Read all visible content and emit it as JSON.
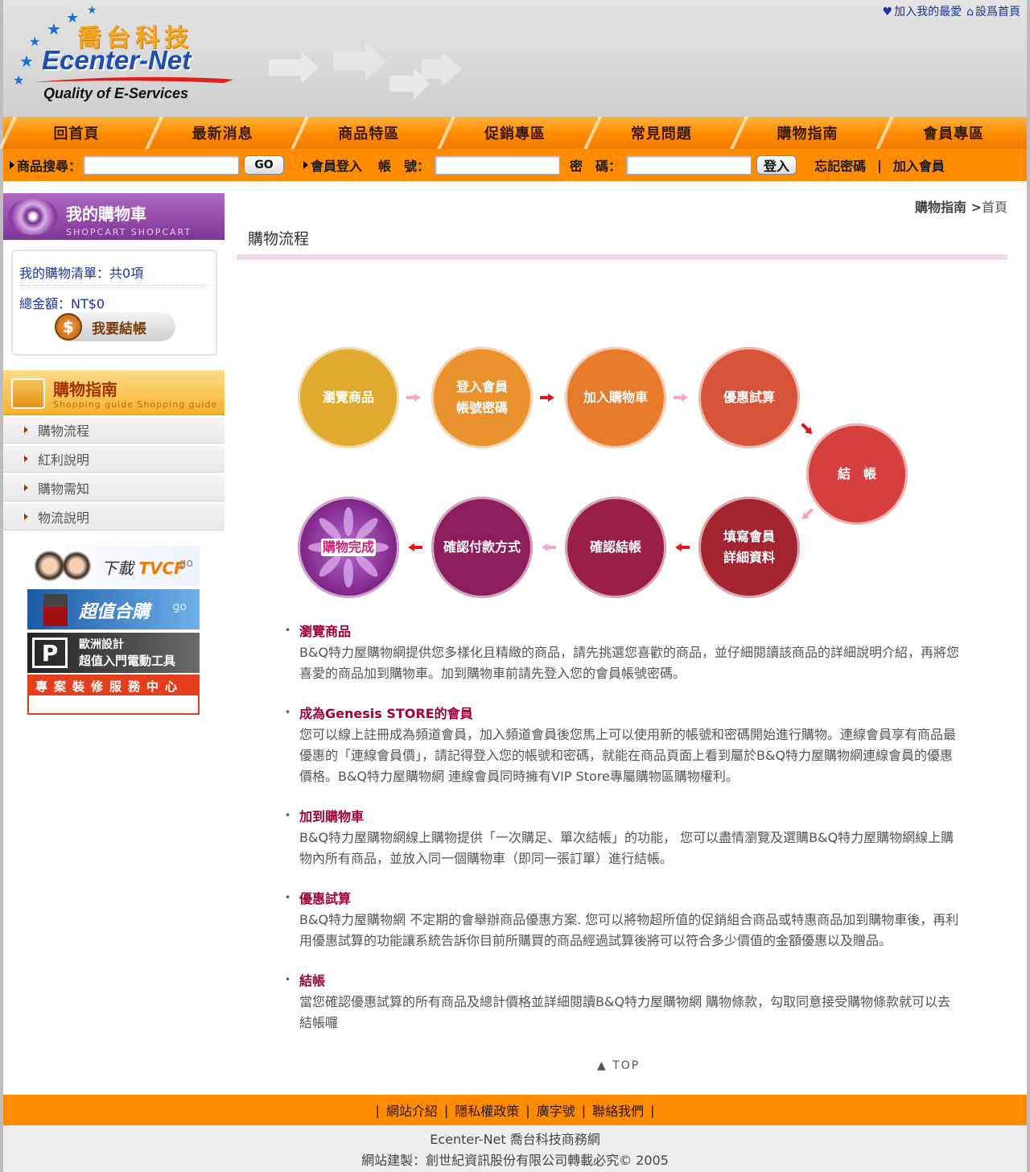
{
  "header": {
    "logo_cn": "喬台科技",
    "logo_en": "Ecenter-Net",
    "logo_tagline": "Quality of E-Services",
    "top_links": [
      {
        "label": "加入我的最愛",
        "icon": "heart-icon"
      },
      {
        "label": "設爲首頁",
        "icon": "home-icon"
      }
    ]
  },
  "nav": {
    "items": [
      "回首頁",
      "最新消息",
      "商品特區",
      "促銷專區",
      "常見問題",
      "購物指南",
      "會員專區"
    ]
  },
  "searchbar": {
    "search_label": "商品搜尋：",
    "search_value": "",
    "go_label": "GO",
    "login_label": "會員登入",
    "account_label": "帳　號：",
    "account_value": "",
    "password_label": "密　碼：",
    "password_value": "",
    "login_button": "登入",
    "forgot_label": "忘記密碼",
    "separator": "|",
    "join_label": "加入會員"
  },
  "cart": {
    "title": "我的購物車",
    "subtitle": "SHOPCART  SHOPCART",
    "list_label": "我的購物清單：共0項",
    "total_label": "總金額：NT$0",
    "checkout_label": "我要結帳",
    "dollar_symbol": "$"
  },
  "guide": {
    "title": "購物指南",
    "subtitle": "Shopping guide  Shopping guide",
    "items": [
      "購物流程",
      "紅利說明",
      "購物需知",
      "物流說明"
    ]
  },
  "banners": {
    "tvcf_text": "下載",
    "tvcf_brand": "TVCF",
    "tvcf_go": "go",
    "super_text": "超值合購",
    "super_go": "go",
    "euro_p": "P",
    "euro_line1": "歐洲設計",
    "euro_line2": "超值入門電動工具",
    "pro_text": "專案裝修服務中心"
  },
  "main": {
    "breadcrumb_section": "購物指南",
    "breadcrumb_sep": " >",
    "breadcrumb_page": "首頁",
    "title": "購物流程",
    "flow_steps": [
      {
        "line1": "瀏覽商品",
        "line2": "",
        "color": "#e0a92f"
      },
      {
        "line1": "登入會員",
        "line2": "帳號密碼",
        "color": "#ea922e"
      },
      {
        "line1": "加入購物車",
        "line2": "",
        "color": "#e87a2c"
      },
      {
        "line1": "優惠試算",
        "line2": "",
        "color": "#d6543a"
      },
      {
        "line1": "結　帳",
        "line2": "",
        "color": "#d6403e"
      },
      {
        "line1": "填寫會員",
        "line2": "詳細資料",
        "color": "#a52431"
      },
      {
        "line1": "確認結帳",
        "line2": "",
        "color": "#9a1f48"
      },
      {
        "line1": "確認付款方式",
        "line2": "",
        "color": "#8d1d5c"
      },
      {
        "line1": "購物完成",
        "line2": "",
        "color": "#7d2283"
      }
    ],
    "items": [
      {
        "title": "瀏覽商品",
        "text": "B&Q特力屋購物網提供您多樣化且精緻的商品，請先挑選您喜歡的商品，並仔細閱讀該商品的詳細說明介紹，再將您喜愛的商品加到購物車。加到購物車前請先登入您的會員帳號密碼。"
      },
      {
        "title": "成為Genesis STORE的會員",
        "text": "您可以線上註冊成為頻道會員，加入頻道會員後您馬上可以使用新的帳號和密碼開始進行購物。連線會員享有商品最優惠的「連線會員價」，請記得登入您的帳號和密碼，就能在商品頁面上看到屬於B&Q特力屋購物網連線會員的優惠價格。B&Q特力屋購物網 連線會員同時擁有VIP Store專屬購物區購物權利。"
      },
      {
        "title": "加到購物車",
        "text": "B&Q特力屋購物網線上購物提供「一次購足、單次結帳」的功能， 您可以盡情瀏覽及選購B&Q特力屋購物網線上購物內所有商品，並放入同一個購物車（即同一張訂單）進行結帳。"
      },
      {
        "title": "優惠試算",
        "text": "B&Q特力屋購物網 不定期的會舉辦商品優惠方案. 您可以將物超所值的促銷組合商品或特惠商品加到購物車後，再利用優惠試算的功能讓系統告訴你目前所購買的商品經過試算後將可以符合多少價值的金額優惠以及贈品。"
      },
      {
        "title": "結帳",
        "text": "當您確認優惠試算的所有商品及總計價格並詳細閱讀B&Q特力屋購物網 購物條款，勾取同意接受購物條款就可以去結帳囉"
      }
    ],
    "to_top": "TOP"
  },
  "footer": {
    "links": [
      "網站介紹",
      "隱私權政策",
      "廣字號",
      "聯絡我們"
    ],
    "sep": "|",
    "line1": "Ecenter-Net 喬台科技商務網",
    "line2": "網站建製：創世紀資訊股份有限公司轉載必究© 2005"
  }
}
